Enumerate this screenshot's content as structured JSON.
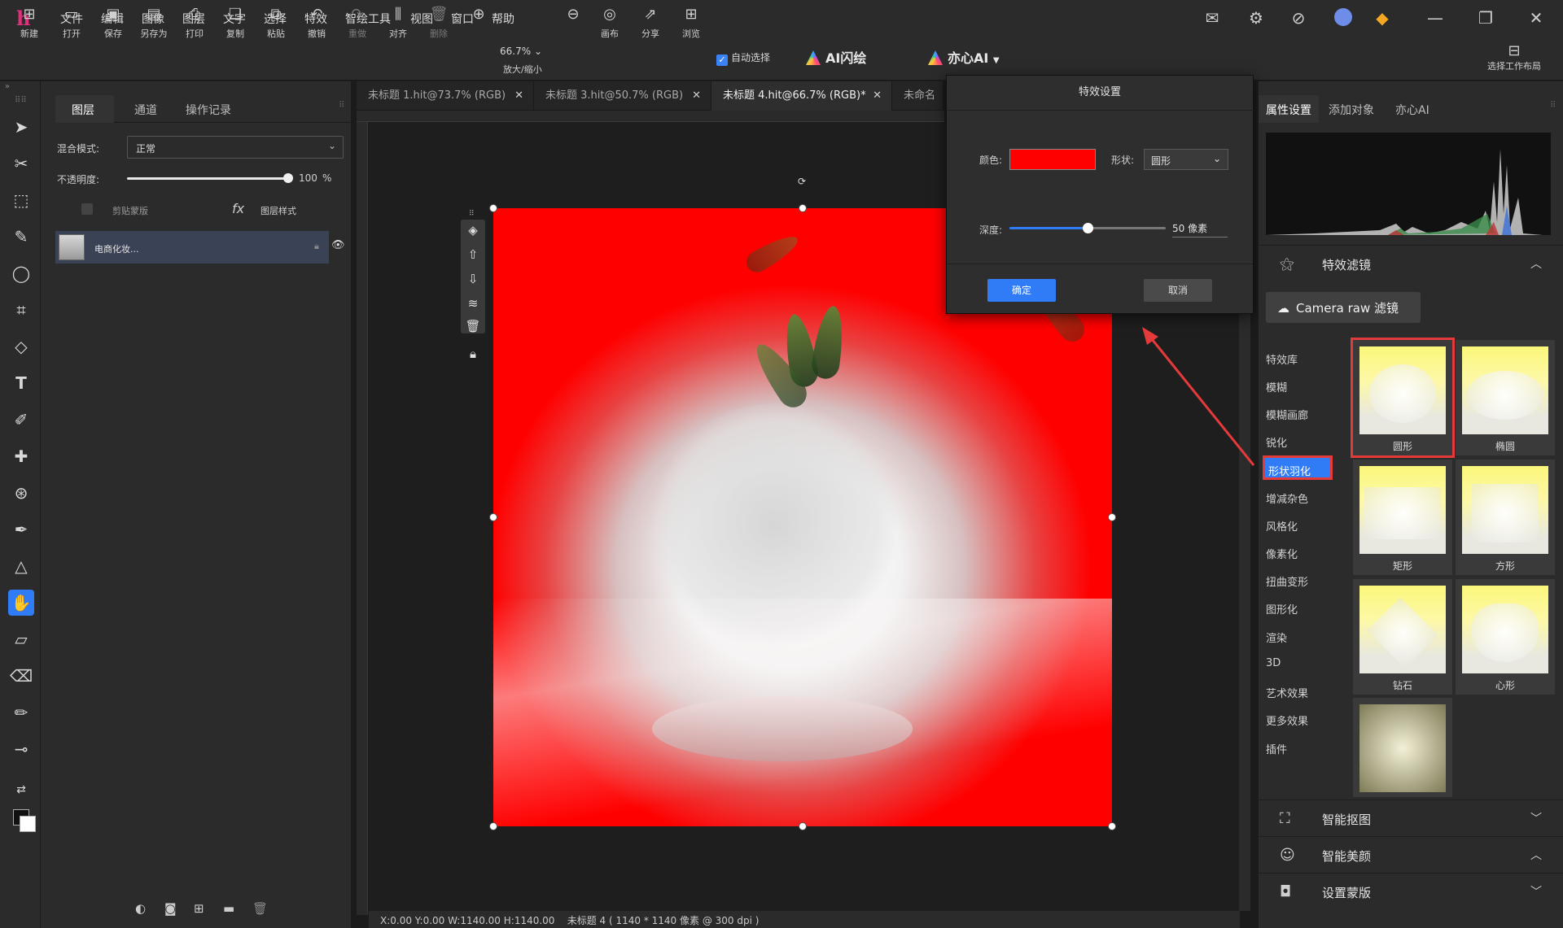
{
  "app": {
    "menu": [
      "文件",
      "编辑",
      "图像",
      "图层",
      "文字",
      "选择",
      "特效",
      "智绘工具",
      "视图",
      "窗口",
      "帮助"
    ]
  },
  "toolbar": {
    "buttons": [
      "新建",
      "打开",
      "保存",
      "另存为",
      "打印",
      "复制",
      "粘贴",
      "撤销",
      "重做",
      "对齐",
      "删除"
    ],
    "zoom_value": "66.7%",
    "zoom_label": "放大/缩小",
    "buttons2": [
      "画布",
      "分享",
      "浏览"
    ],
    "auto_select": "自动选择",
    "ai_flash": "AI闪绘",
    "ai_yixin": "亦心AI",
    "workspace": "选择工作布局"
  },
  "layers_panel": {
    "tabs": [
      "图层",
      "通道",
      "操作记录"
    ],
    "blend_label": "混合模式:",
    "blend_value": "正常",
    "opacity_label": "不透明度:",
    "opacity_value": "100",
    "opacity_unit": "%",
    "opacity_level": 1.0,
    "clip_label": "剪贴蒙版",
    "style_label": "图层样式",
    "layer_name": "电商化妆..."
  },
  "doc_tabs": [
    {
      "label": "未标题 1.hit@73.7% (RGB)",
      "active": false
    },
    {
      "label": "未标题 3.hit@50.7% (RGB)",
      "active": false
    },
    {
      "label": "未标题 4.hit@66.7% (RGB)*",
      "active": true
    },
    {
      "label": "未命名",
      "active": false
    }
  ],
  "status": {
    "coords": "X:0.00 Y:0.00 W:1140.00 H:1140.00",
    "doc_info": "未标题 4 ( 1140 * 1140 像素 @ 300 dpi )"
  },
  "dialog": {
    "title": "特效设置",
    "color_label": "颜色:",
    "color_value": "#ff0000",
    "shape_label": "形状:",
    "shape_value": "圆形",
    "depth_label": "深度:",
    "depth_value": "50",
    "depth_unit": "像素",
    "depth_level": 0.5,
    "ok": "确定",
    "cancel": "取消"
  },
  "right_panel": {
    "tabs": [
      "属性设置",
      "添加对象",
      "亦心AI"
    ],
    "effects_title": "特效滤镜",
    "camera_raw": "Camera raw 滤镜",
    "categories": [
      "特效库",
      "模糊",
      "模糊画廊",
      "锐化",
      "形状羽化",
      "增减杂色",
      "风格化",
      "像素化",
      "扭曲变形",
      "图形化",
      "渲染",
      "3D",
      "艺术效果",
      "更多效果",
      "插件"
    ],
    "active_category": "形状羽化",
    "thumbs": [
      "圆形",
      "椭圆",
      "矩形",
      "方形",
      "钻石",
      "心形",
      ""
    ],
    "sections": [
      "智能抠图",
      "智能美颜",
      "设置蒙版"
    ]
  },
  "colors": {
    "accent": "#2f7cf6",
    "highlight": "#e53a3a",
    "canvas_fill": "#ff0000"
  }
}
